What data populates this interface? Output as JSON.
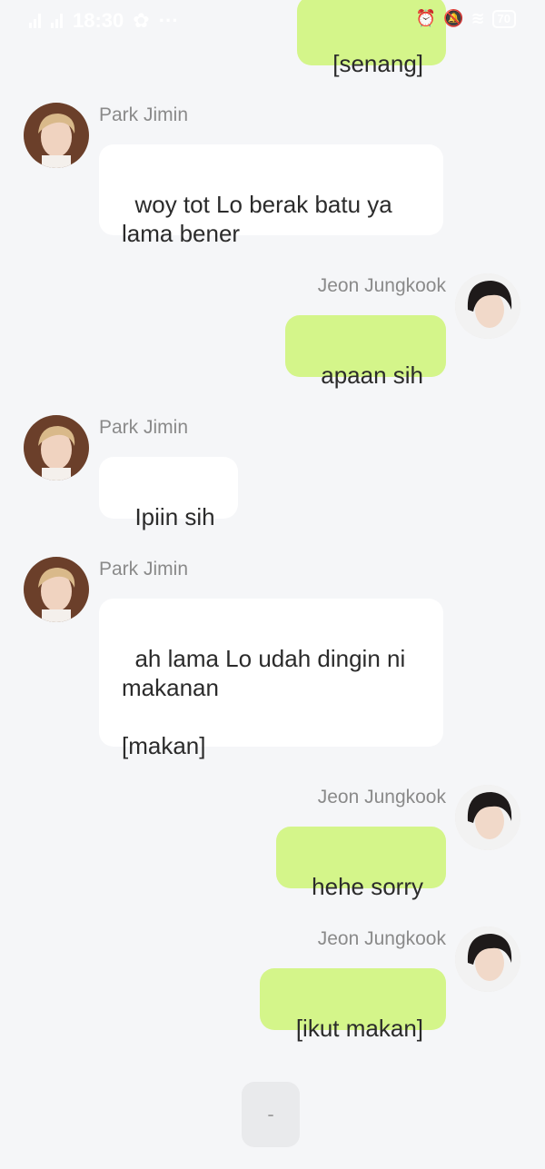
{
  "status_bar": {
    "time": "18:30",
    "more": "···",
    "battery": "70"
  },
  "participants": {
    "jimin": "Park Jimin",
    "jungkook": "Jeon Jungkook"
  },
  "messages": [
    {
      "sender": "Jeon Jungkook",
      "text": "[senang]"
    },
    {
      "sender": "Park Jimin",
      "text": "woy tot Lo berak batu ya\nlama bener"
    },
    {
      "sender": "Jeon Jungkook",
      "text": "apaan sih"
    },
    {
      "sender": "Park Jimin",
      "text": "Ipiin sih"
    },
    {
      "sender": "Park Jimin",
      "text": "ah lama Lo udah dingin ni\nmakanan\n\n[makan]"
    },
    {
      "sender": "Jeon Jungkook",
      "text": "hehe sorry"
    },
    {
      "sender": "Jeon Jungkook",
      "text": "[ikut makan]"
    }
  ],
  "bottom_button": {
    "label": "-"
  },
  "colors": {
    "background": "#f5f6f8",
    "incoming_bubble": "#ffffff",
    "outgoing_bubble": "#d4f58a",
    "name_text": "#8a8a8a"
  }
}
